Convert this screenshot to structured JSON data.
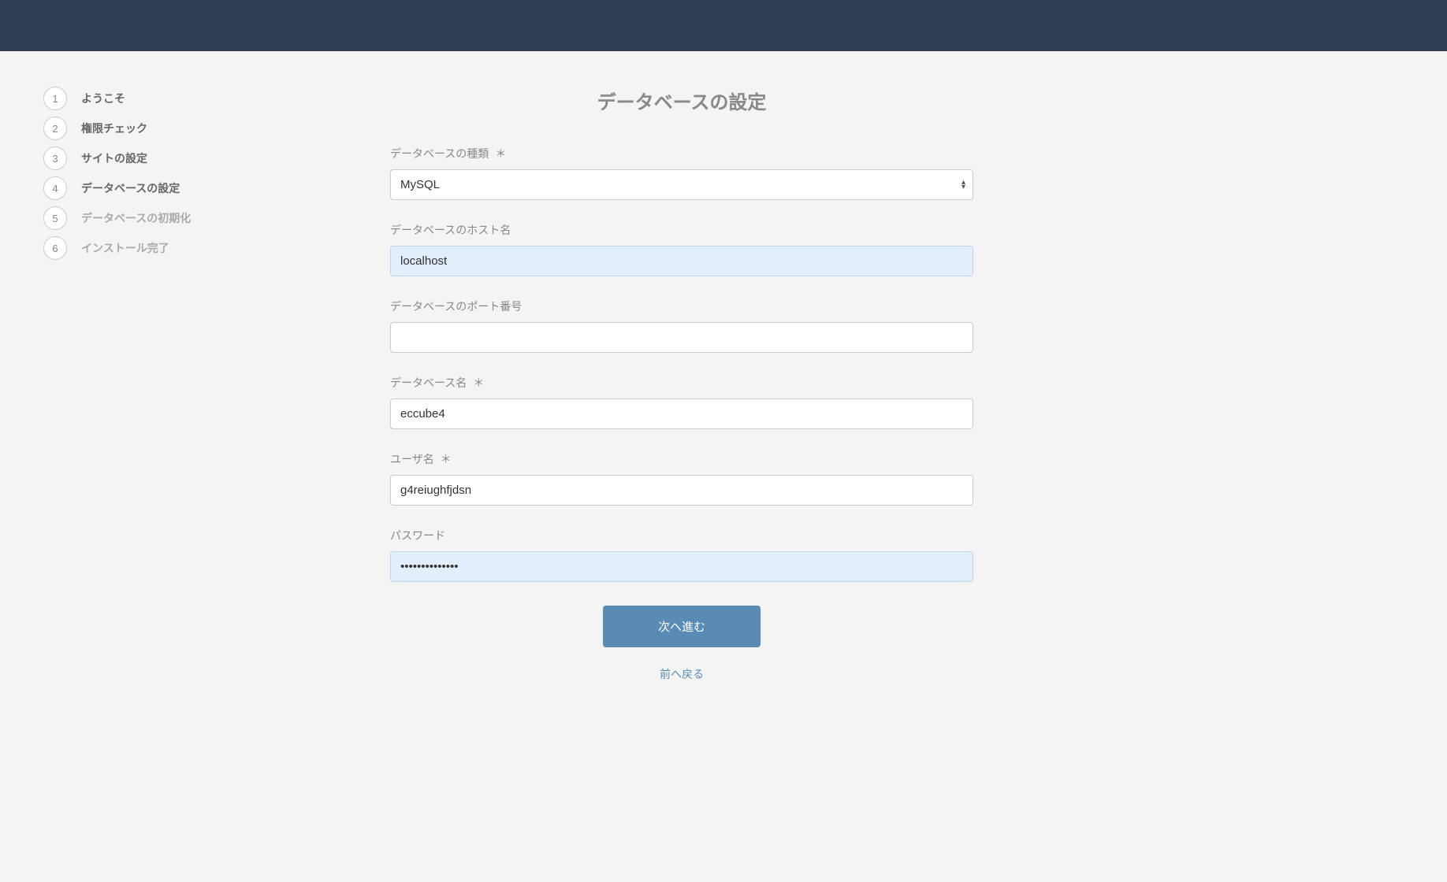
{
  "steps": [
    {
      "number": "1",
      "label": "ようこそ",
      "state": "completed"
    },
    {
      "number": "2",
      "label": "権限チェック",
      "state": "completed"
    },
    {
      "number": "3",
      "label": "サイトの設定",
      "state": "completed"
    },
    {
      "number": "4",
      "label": "データベースの設定",
      "state": "active"
    },
    {
      "number": "5",
      "label": "データベースの初期化",
      "state": "upcoming"
    },
    {
      "number": "6",
      "label": "インストール完了",
      "state": "upcoming"
    }
  ],
  "page": {
    "title": "データベースの設定"
  },
  "form": {
    "database_type": {
      "label": "データベースの種類",
      "required": "＊",
      "value": "MySQL"
    },
    "database_host": {
      "label": "データベースのホスト名",
      "value": "localhost"
    },
    "database_port": {
      "label": "データベースのポート番号",
      "value": ""
    },
    "database_name": {
      "label": "データベース名",
      "required": "＊",
      "value": "eccube4"
    },
    "username": {
      "label": "ユーザ名",
      "required": "＊",
      "value": "g4reiughfjdsn"
    },
    "password": {
      "label": "パスワード",
      "value": "••••••••••••••"
    }
  },
  "buttons": {
    "next": "次へ進む",
    "back": "前へ戻る"
  }
}
